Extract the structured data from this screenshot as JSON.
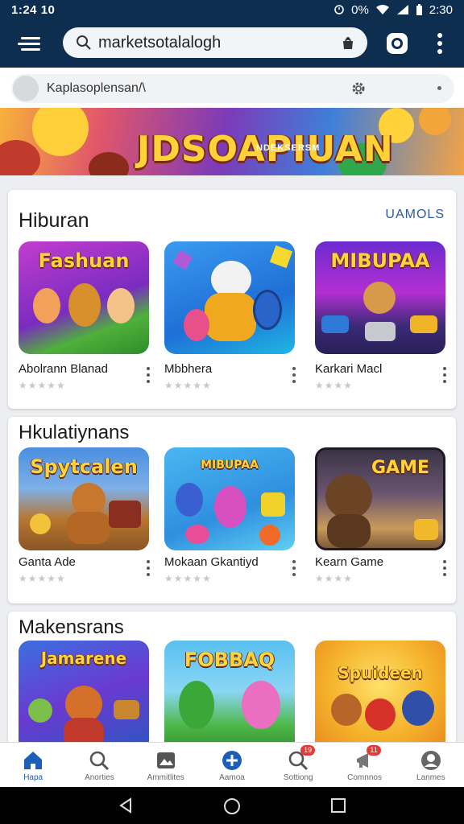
{
  "status_bar": {
    "time_left": "1:24 10",
    "battery": "0%",
    "time_right": "2:30"
  },
  "search": {
    "query": "marketsotalalogh"
  },
  "sub_search": {
    "text": "Kaplasoplensan/\\"
  },
  "banner": {
    "title": "JDSOAPIUAN",
    "subtitle": "NDEKSERSM"
  },
  "sections": [
    {
      "title": "Hiburan",
      "link": "UAMOLS",
      "items": [
        {
          "name": "Abolrann Blanad",
          "art": "Fashuan",
          "stars": "★★★★★"
        },
        {
          "name": "Mbbhera",
          "art": "",
          "stars": "★★★★★"
        },
        {
          "name": "Karkari Macl",
          "art": "MIBUPAA",
          "stars": "★★★★"
        }
      ]
    },
    {
      "title": "Hkulatiynans",
      "items": [
        {
          "name": "Ganta Ade",
          "art": "Spytcalen",
          "stars": "★★★★★"
        },
        {
          "name": "Mokaan Gkantiyd",
          "art": "MIBUPAA",
          "stars": "★★★★★"
        },
        {
          "name": "Kearn Game",
          "art": "GAME",
          "stars": "★★★★"
        }
      ]
    },
    {
      "title": "Makensrans",
      "items": [
        {
          "name": "",
          "art": "Jamarene",
          "stars": ""
        },
        {
          "name": "",
          "art": "FOBBAQ",
          "stars": ""
        },
        {
          "name": "",
          "art": "Spuideen",
          "stars": ""
        }
      ]
    }
  ],
  "bottom_nav": [
    {
      "label": "Hapa",
      "icon": "home-icon",
      "active": true
    },
    {
      "label": "Anorties",
      "icon": "search-icon"
    },
    {
      "label": "Ammitlites",
      "icon": "gallery-icon"
    },
    {
      "label": "Aamoa",
      "icon": "add-circle-icon"
    },
    {
      "label": "Sottiong",
      "icon": "search-badge-icon",
      "badge": "19"
    },
    {
      "label": "Comnnos",
      "icon": "megaphone-icon",
      "badge": "11"
    },
    {
      "label": "Lanmes",
      "icon": "person-icon"
    }
  ],
  "colors": {
    "app_bar": "#0d2e4e",
    "accent": "#1d5fb8",
    "link": "#2d5a9e"
  }
}
